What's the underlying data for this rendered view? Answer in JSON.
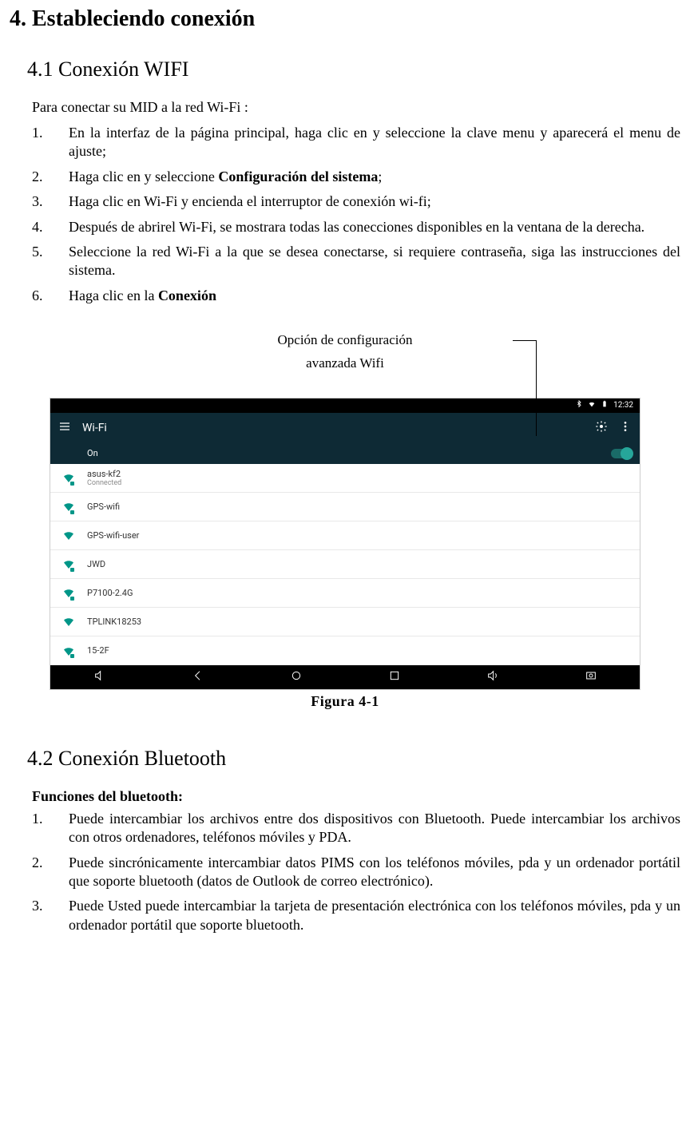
{
  "sec4": {
    "title": "4. Estableciendo conexión",
    "s41": {
      "title": "4.1 Conexión WIFI",
      "intro": "Para conectar su MID a la red Wi-Fi :",
      "items": [
        {
          "n": "1.",
          "pre": "En la interfaz de la página principal, haga clic en y seleccione la clave menu y aparecerá el menu de ajuste;"
        },
        {
          "n": "2.",
          "pre": "Haga clic en y seleccione ",
          "bold": "Configuración del sistema",
          "post": ";"
        },
        {
          "n": "3.",
          "pre": "Haga clic en Wi-Fi y encienda el interruptor de conexión wi-fi;"
        },
        {
          "n": "4.",
          "pre": "Después de abrirel Wi-Fi, se mostrara todas las conecciones disponibles en la ventana de la derecha."
        },
        {
          "n": "5.",
          "pre": "Seleccione la red Wi-Fi a la que se desea conectarse, si requiere contraseña, siga las instrucciones del sistema."
        },
        {
          "n": "6.",
          "pre": "Haga clic en la ",
          "bold": "Conexión"
        }
      ],
      "callout": {
        "line1": "Opción de configuración",
        "line2": "avanzada Wifi"
      },
      "fig": "Figura    4-1"
    },
    "screenshot": {
      "time": "12:32",
      "appbar_title": "Wi-Fi",
      "on_label": "On",
      "networks": [
        {
          "name": "asus-kf2",
          "sub": "Connected",
          "locked": true
        },
        {
          "name": "GPS-wifi",
          "locked": true
        },
        {
          "name": "GPS-wifi-user",
          "locked": false
        },
        {
          "name": "JWD",
          "locked": true
        },
        {
          "name": "P7100-2.4G",
          "locked": true
        },
        {
          "name": "TPLINK18253",
          "locked": false
        },
        {
          "name": "15-2F",
          "locked": true
        }
      ]
    },
    "s42": {
      "title": "4.2 Conexión Bluetooth",
      "subheading": "Funciones del bluetooth:",
      "items": [
        {
          "n": "1.",
          "pre": "Puede intercambiar los archivos entre dos dispositivos con Bluetooth. Puede intercambiar los archivos con otros ordenadores, teléfonos móviles y PDA."
        },
        {
          "n": "2.",
          "pre": "Puede sincrónicamente intercambiar datos PIMS con los teléfonos móviles, pda y un ordenador portátil que soporte bluetooth (datos de Outlook de correo electrónico)."
        },
        {
          "n": "3.",
          "pre": "Puede Usted puede intercambiar la tarjeta de presentación electrónica con los teléfonos móviles, pda y un ordenador portátil que soporte bluetooth."
        }
      ]
    }
  }
}
